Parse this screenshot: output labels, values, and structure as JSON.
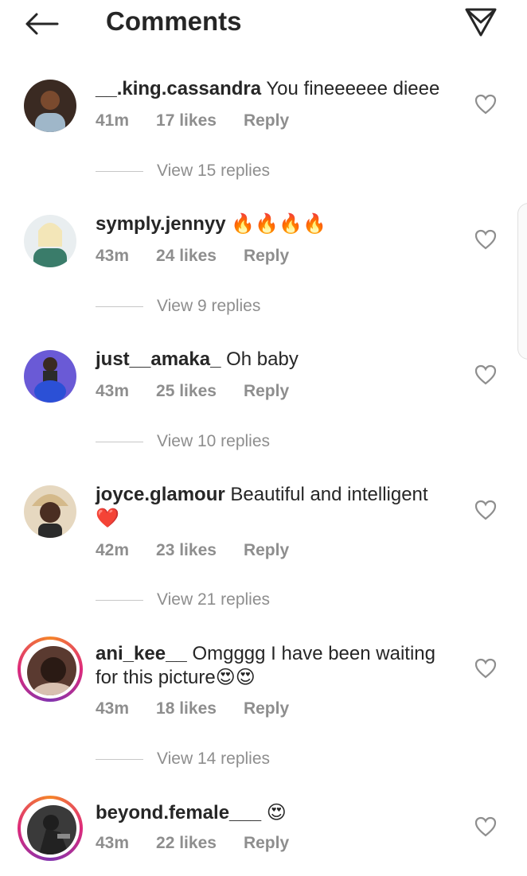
{
  "header": {
    "title": "Comments",
    "back_icon": "arrow-left-icon",
    "share_icon": "paper-plane-icon"
  },
  "comments": [
    {
      "username": "__.king.cassandra",
      "text": "You fineeeeee dieee",
      "time": "41m",
      "likes": "17 likes",
      "reply": "Reply",
      "view_replies": "View 15 replies"
    },
    {
      "username": "symply.jennyy",
      "text": "🔥🔥🔥🔥",
      "time": "43m",
      "likes": "24 likes",
      "reply": "Reply",
      "view_replies": "View 9 replies"
    },
    {
      "username": "just__amaka_",
      "text": "Oh baby",
      "time": "43m",
      "likes": "25 likes",
      "reply": "Reply",
      "view_replies": "View 10 replies"
    },
    {
      "username": "joyce.glamour",
      "text": "Beautiful and intelligent ❤️",
      "time": "42m",
      "likes": "23 likes",
      "reply": "Reply",
      "view_replies": "View 21 replies"
    },
    {
      "username": "ani_kee__",
      "text": "Omgggg I have been waiting for this picture😍😍",
      "time": "43m",
      "likes": "18 likes",
      "reply": "Reply",
      "view_replies": "View 14 replies"
    },
    {
      "username": "beyond.female___",
      "text": "😍",
      "time": "43m",
      "likes": "22 likes",
      "reply": "Reply",
      "view_replies": ""
    }
  ],
  "colors": {
    "text": "#262626",
    "muted": "#8e8e8e",
    "story_ring": "#dd2a7b"
  }
}
